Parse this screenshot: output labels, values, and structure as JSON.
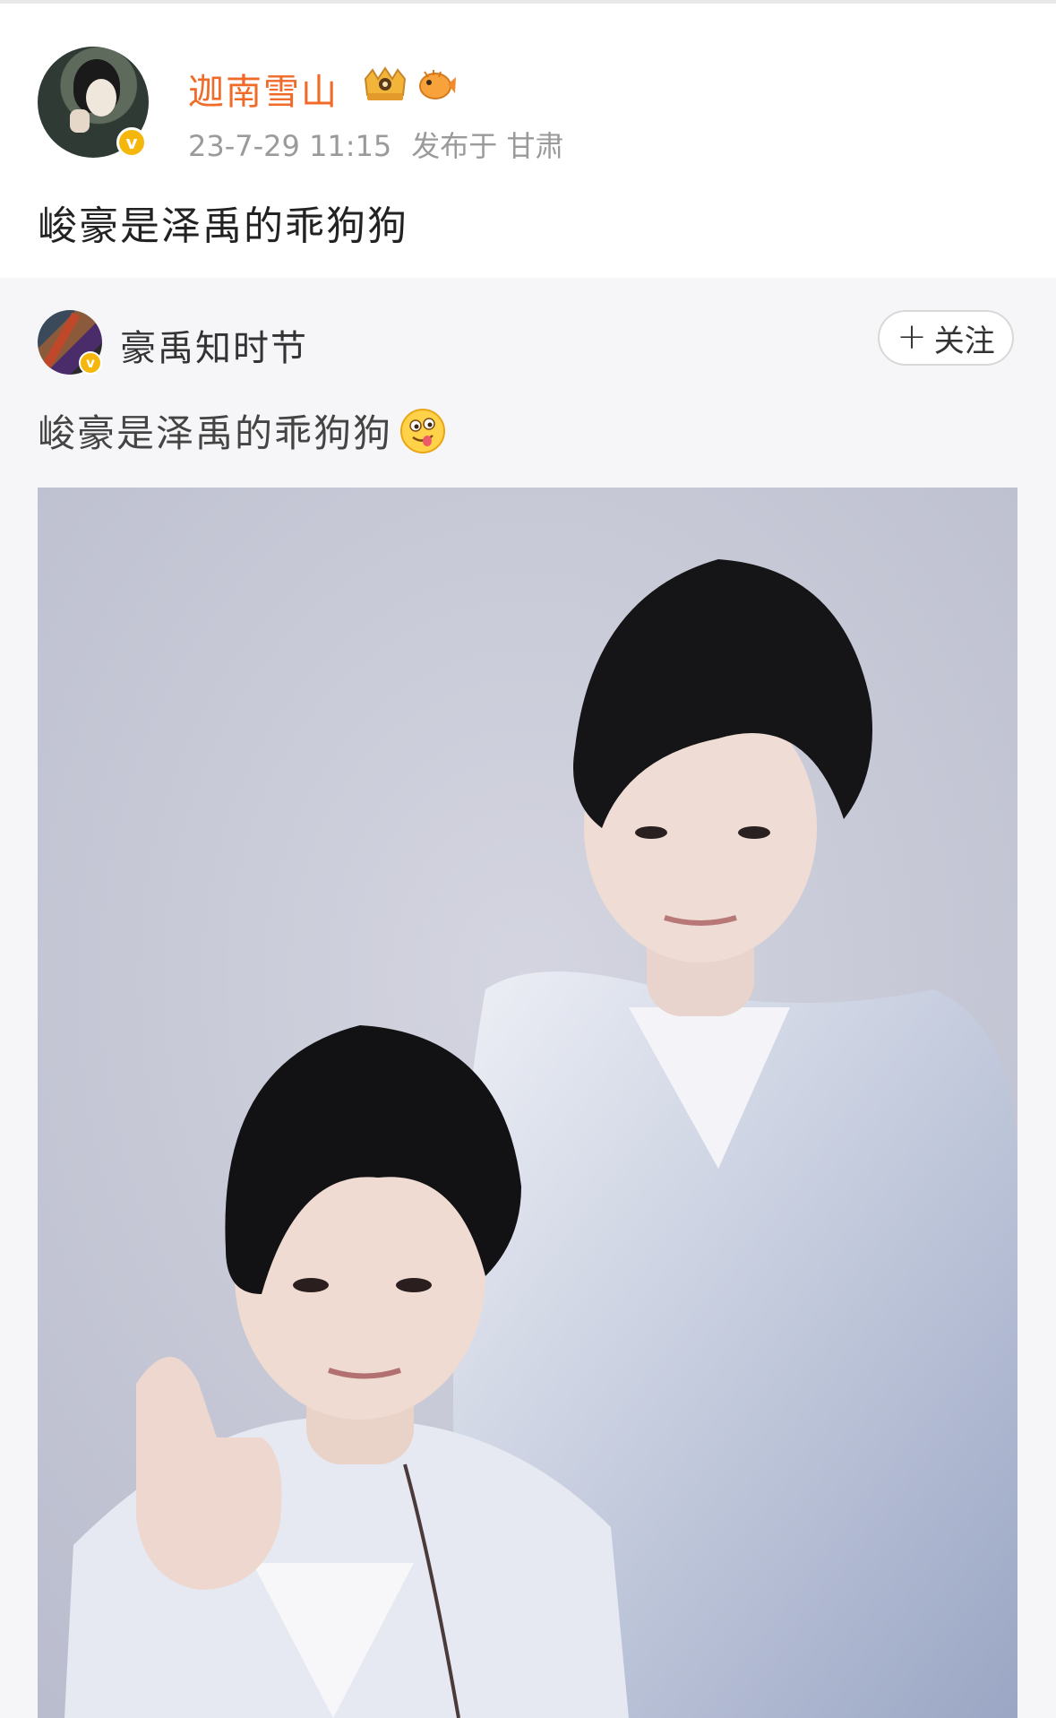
{
  "post": {
    "author": "迦南雪山",
    "timestamp": "23-7-29 11:15",
    "location": "发布于 甘肃",
    "text": "峻豪是泽禹的乖狗狗",
    "badges": [
      "crown-badge-icon",
      "fish-badge-icon"
    ],
    "verified_icon": "v"
  },
  "retweet": {
    "author": "豪禹知时节",
    "verified_icon": "v",
    "follow_label": "关注",
    "follow_plus": "+",
    "text": "峻豪是泽禹的乖狗狗",
    "emoji": "drooling-face-emoji"
  },
  "colors": {
    "username_orange": "#f06a28",
    "meta_gray": "#9a9a9a",
    "verified_gold": "#f6b70d",
    "retweet_bg": "#f6f6f8"
  }
}
